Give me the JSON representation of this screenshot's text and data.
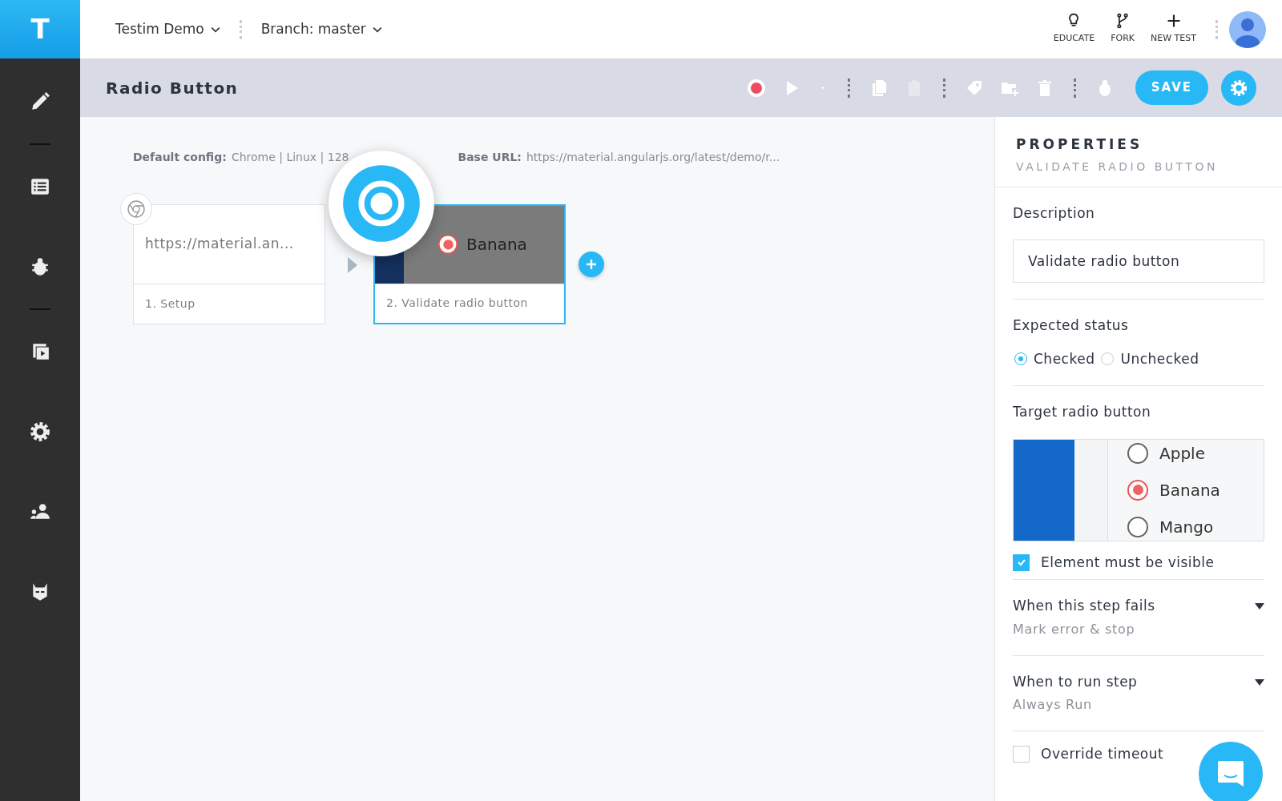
{
  "logo": "T",
  "topbar": {
    "project": "Testim Demo",
    "branch": "Branch: master",
    "actions": [
      {
        "kind": "bulb",
        "label": "EDUCATE"
      },
      {
        "kind": "fork",
        "label": "FORK"
      },
      {
        "kind": "plus",
        "label": "NEW TEST"
      }
    ]
  },
  "sidebar": {
    "items": [
      {
        "kind": "pencil"
      },
      {
        "kind": "divider"
      },
      {
        "kind": "list"
      },
      {
        "kind": "bug"
      },
      {
        "kind": "divider"
      },
      {
        "kind": "play"
      },
      {
        "kind": "gear"
      },
      {
        "kind": "people"
      },
      {
        "kind": "mask"
      }
    ]
  },
  "toolbar": {
    "title": "Radio Button",
    "save": "SAVE",
    "settings_selected": true
  },
  "canvas": {
    "config_label": "Default config:",
    "config_value": "Chrome | Linux | 128",
    "base_url_label": "Base URL:",
    "base_url": "https://material.angularjs.org/latest/demo/r...",
    "steps": [
      {
        "kind": "browser",
        "url": "https://material.an...",
        "label": "1. Setup",
        "selected": false
      },
      {
        "kind": "screenshot",
        "option": "Banana",
        "label": "2. Validate radio button",
        "selected": true
      }
    ]
  },
  "properties": {
    "title": "PROPERTIES",
    "subtitle": "VALIDATE RADIO BUTTON",
    "description_label": "Description",
    "description": "Validate radio button",
    "status_label": "Expected status",
    "status_options": [
      {
        "label": "Checked",
        "selected": true
      },
      {
        "label": "Unchecked",
        "selected": false
      }
    ],
    "target_label": "Target radio button",
    "target_options": [
      {
        "label": "Apple",
        "selected": false
      },
      {
        "label": "Banana",
        "selected": true
      },
      {
        "label": "Mango",
        "selected": false
      }
    ],
    "visible": {
      "label": "Element must be visible",
      "checked": true
    },
    "dropdowns": [
      {
        "label": "When this step fails",
        "value": "Mark error & stop"
      },
      {
        "label": "When to run step",
        "value": "Always Run"
      }
    ],
    "override": {
      "label": "Override timeout",
      "checked": false
    }
  }
}
